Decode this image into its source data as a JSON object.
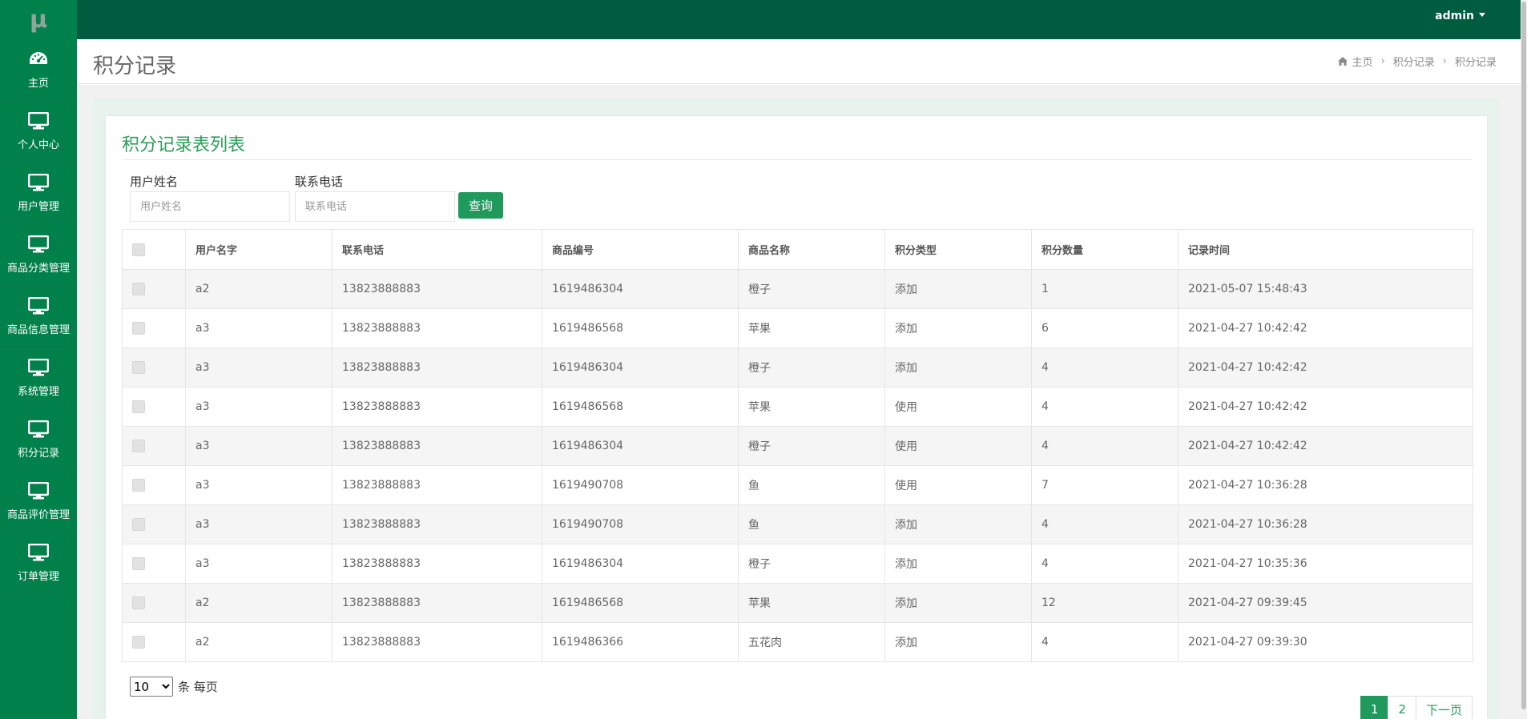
{
  "logo": "μ",
  "sidebar": {
    "items": [
      {
        "label": "主页",
        "icon": "dashboard-icon"
      },
      {
        "label": "个人中心",
        "icon": "monitor-icon"
      },
      {
        "label": "用户管理",
        "icon": "monitor-icon"
      },
      {
        "label": "商品分类管理",
        "icon": "monitor-icon"
      },
      {
        "label": "商品信息管理",
        "icon": "monitor-icon"
      },
      {
        "label": "系统管理",
        "icon": "monitor-icon"
      },
      {
        "label": "积分记录",
        "icon": "monitor-icon"
      },
      {
        "label": "商品评价管理",
        "icon": "monitor-icon"
      },
      {
        "label": "订单管理",
        "icon": "monitor-icon"
      }
    ]
  },
  "topbar": {
    "user": "admin"
  },
  "header": {
    "title": "积分记录",
    "breadcrumb": [
      "主页",
      "积分记录",
      "积分记录"
    ]
  },
  "panel": {
    "title": "积分记录表列表",
    "filters": {
      "username_label": "用户姓名",
      "username_placeholder": "用户姓名",
      "phone_label": "联系电话",
      "phone_placeholder": "联系电话",
      "search_label": "查询"
    },
    "table": {
      "columns": [
        "用户名字",
        "联系电话",
        "商品编号",
        "商品名称",
        "积分类型",
        "积分数量",
        "记录时间"
      ],
      "rows": [
        [
          "a2",
          "13823888883",
          "1619486304",
          "橙子",
          "添加",
          "1",
          "2021-05-07 15:48:43"
        ],
        [
          "a3",
          "13823888883",
          "1619486568",
          "苹果",
          "添加",
          "6",
          "2021-04-27 10:42:42"
        ],
        [
          "a3",
          "13823888883",
          "1619486304",
          "橙子",
          "添加",
          "4",
          "2021-04-27 10:42:42"
        ],
        [
          "a3",
          "13823888883",
          "1619486568",
          "苹果",
          "使用",
          "4",
          "2021-04-27 10:42:42"
        ],
        [
          "a3",
          "13823888883",
          "1619486304",
          "橙子",
          "使用",
          "4",
          "2021-04-27 10:42:42"
        ],
        [
          "a3",
          "13823888883",
          "1619490708",
          "鱼",
          "使用",
          "7",
          "2021-04-27 10:36:28"
        ],
        [
          "a3",
          "13823888883",
          "1619490708",
          "鱼",
          "添加",
          "4",
          "2021-04-27 10:36:28"
        ],
        [
          "a3",
          "13823888883",
          "1619486304",
          "橙子",
          "添加",
          "4",
          "2021-04-27 10:35:36"
        ],
        [
          "a2",
          "13823888883",
          "1619486568",
          "苹果",
          "添加",
          "12",
          "2021-04-27 09:39:45"
        ],
        [
          "a2",
          "13823888883",
          "1619486366",
          "五花肉",
          "添加",
          "4",
          "2021-04-27 09:39:30"
        ]
      ]
    },
    "page_size": {
      "value": "10",
      "suffix": "条 每页"
    },
    "pagination": {
      "pages": [
        "1",
        "2"
      ],
      "next": "下一页",
      "current": "1"
    }
  },
  "colors": {
    "sidebar": "#00804a",
    "topbar": "#005c3f",
    "accent": "#1f9a5c",
    "title": "#2e9e58"
  }
}
